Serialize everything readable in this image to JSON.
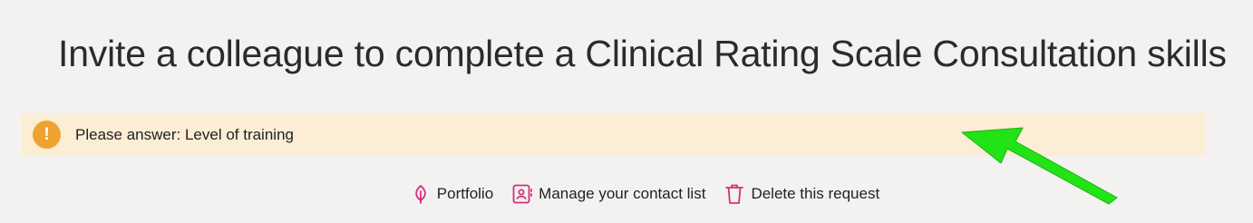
{
  "page": {
    "title": "Invite a colleague to complete a Clinical Rating Scale Consultation skills"
  },
  "alert": {
    "icon": "exclamation-icon",
    "message": "Please answer: Level of training",
    "background": "#fcedd5",
    "icon_color": "#eea331"
  },
  "actions": [
    {
      "label": "Portfolio",
      "icon": "leaf-icon"
    },
    {
      "label": "Manage your contact list",
      "icon": "contact-book-icon"
    },
    {
      "label": "Delete this request",
      "icon": "trash-icon"
    }
  ],
  "colors": {
    "accent": "#d6307b",
    "page_background": "#f3f2f1",
    "annotation_arrow": "#22e316"
  }
}
